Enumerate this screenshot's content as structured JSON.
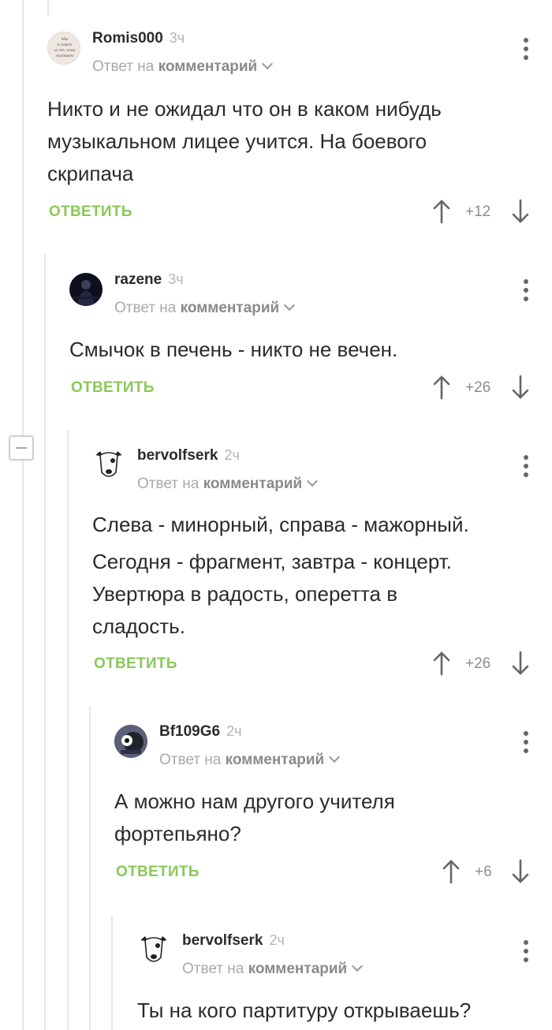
{
  "comments": [
    {
      "username": "Romis000",
      "time": "3ч",
      "reply_prefix": "Ответ на",
      "reply_target": "комментарий",
      "text_lines": [
        "Никто и не ожидал что он в каком нибудь",
        "музыкальном лицее учится. На боевого",
        "скрипача"
      ],
      "reply_label": "ОТВЕТИТЬ",
      "score": "+12",
      "avatar": "avatar-romis000",
      "avatar_text": "Мы в ответе за тех, кому наливаем"
    },
    {
      "username": "razene",
      "time": "3ч",
      "reply_prefix": "Ответ на",
      "reply_target": "комментарий",
      "text_lines": [
        "Смычок в печень - никто не вечен."
      ],
      "reply_label": "ОТВЕТИТЬ",
      "score": "+26",
      "avatar": "avatar-razene"
    },
    {
      "username": "bervolfserk",
      "time": "2ч",
      "reply_prefix": "Ответ на",
      "reply_target": "комментарий",
      "text_lines": [
        "Слева - минорный, справа - мажорный.",
        "Сегодня - фрагмент, завтра - концерт.",
        "Увертюра в радость, оперетта в",
        "сладость."
      ],
      "reply_label": "ОТВЕТИТЬ",
      "score": "+26",
      "avatar": "avatar-bervolfserk"
    },
    {
      "username": "Bf109G6",
      "time": "2ч",
      "reply_prefix": "Ответ на",
      "reply_target": "комментарий",
      "text_lines": [
        "А можно нам другого учителя",
        "фортепьяно?"
      ],
      "reply_label": "ОТВЕТИТЬ",
      "score": "+6",
      "avatar": "avatar-bf109g6"
    },
    {
      "username": "bervolfserk",
      "time": "2ч",
      "reply_prefix": "Ответ на",
      "reply_target": "комментарий",
      "text_lines": [
        "Ты на кого партитуру открываешь?"
      ],
      "avatar": "avatar-bervolfserk"
    }
  ],
  "colors": {
    "accent": "#8ac858",
    "thread_line": "#e6e6e6",
    "meta_text": "#a9a9a9"
  },
  "icons": [
    "more-icon",
    "upvote-arrow-icon",
    "downvote-arrow-icon",
    "chevron-down-icon",
    "collapse-thread-icon"
  ]
}
